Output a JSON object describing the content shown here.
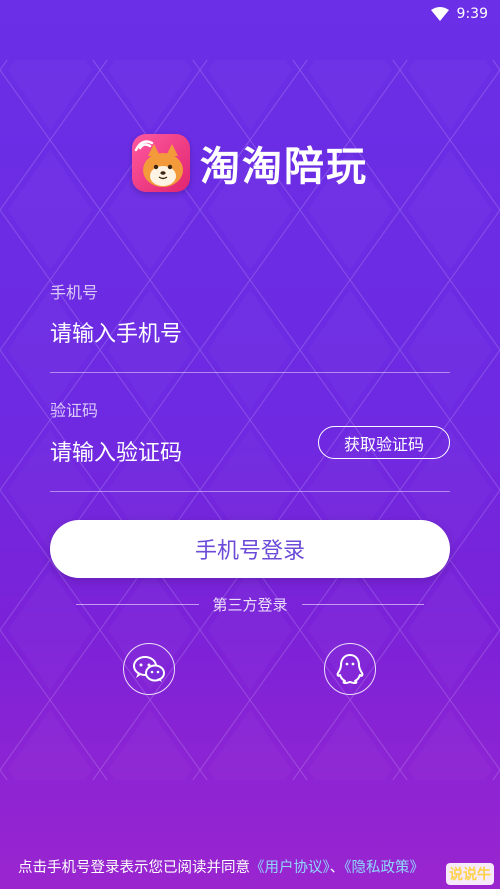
{
  "status_bar": {
    "time": "9:39"
  },
  "app": {
    "title": "淘淘陪玩"
  },
  "phone": {
    "label": "手机号",
    "placeholder": "请输入手机号"
  },
  "code": {
    "label": "验证码",
    "placeholder": "请输入验证码",
    "get_code_label": "获取验证码"
  },
  "login_button_label": "手机号登录",
  "third_party": {
    "label": "第三方登录",
    "providers": [
      "wechat-icon",
      "qq-icon"
    ]
  },
  "agreement": {
    "prefix": "点击手机号登录表示您已阅读并同意",
    "user_agreement": "《用户协议》",
    "separator": "、",
    "privacy_policy": "《隐私政策》"
  },
  "watermark": "说说牛"
}
